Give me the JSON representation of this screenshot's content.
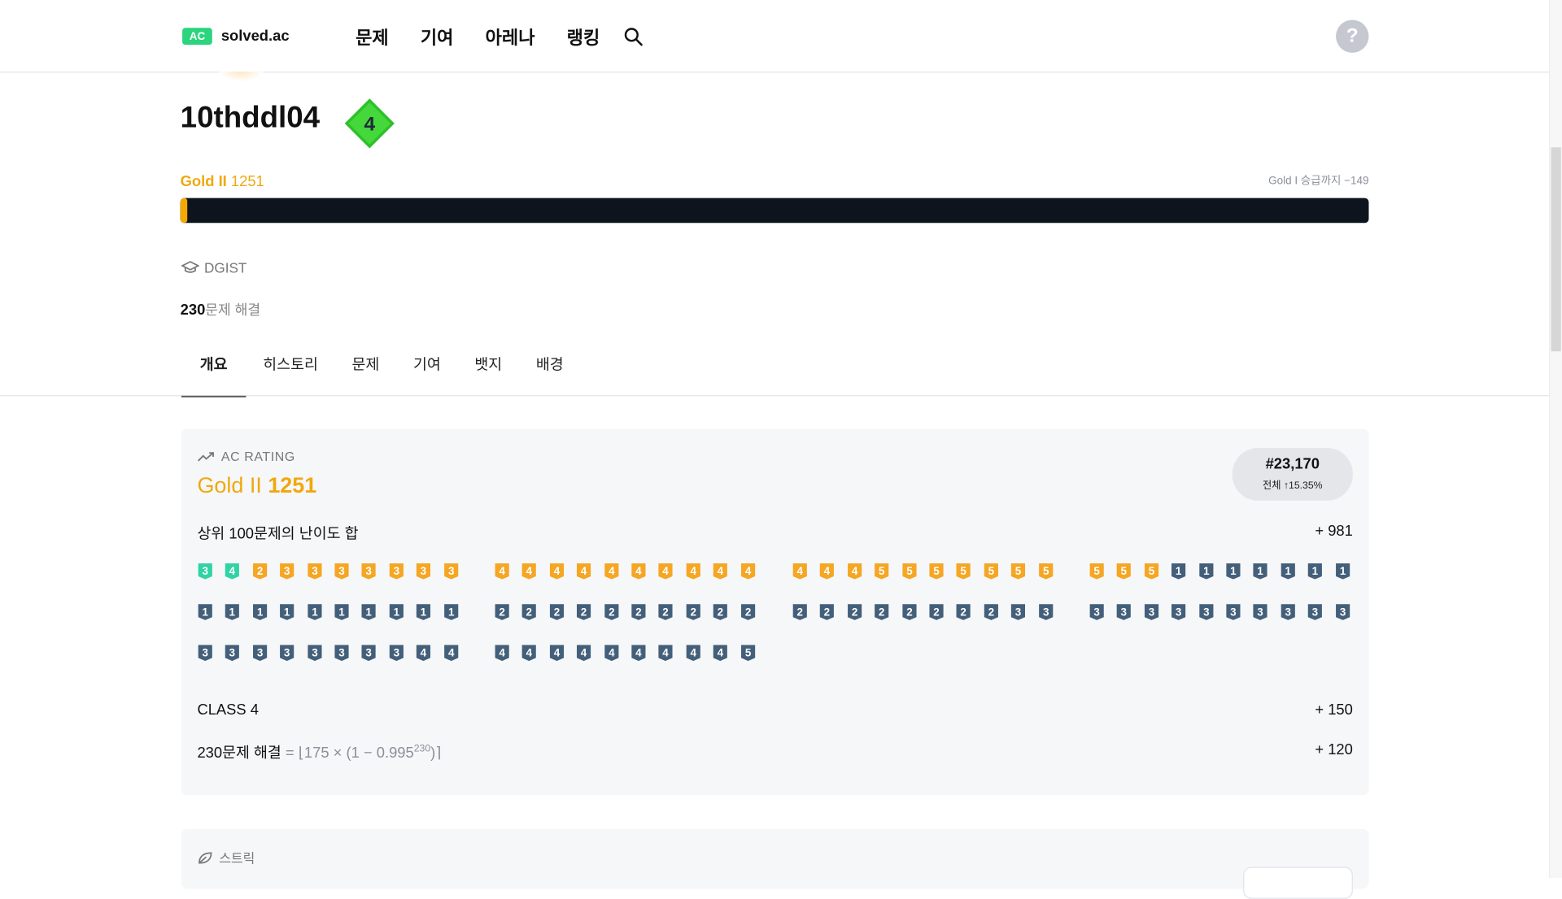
{
  "header": {
    "logo_badge": "AC",
    "logo_text": "solved.ac",
    "nav": [
      "문제",
      "기여",
      "아레나",
      "랭킹"
    ],
    "help_glyph": "?"
  },
  "profile": {
    "username": "10thddl04",
    "class_level": "4",
    "tier": "Gold II",
    "rating": "1251",
    "next_tier_text": "Gold I 승급까지 −149",
    "progress_fraction": 0.006,
    "organization": "DGIST",
    "solved_count": "230",
    "solved_suffix": "문제 해결"
  },
  "tabs": [
    "개요",
    "히스토리",
    "문제",
    "기여",
    "뱃지",
    "배경"
  ],
  "ac_rating": {
    "label": "AC RATING",
    "tier": "Gold II",
    "rating": "1251",
    "rank": "#23,170",
    "rank_sub": "전체 ↑15.35%",
    "top100_label": "상위 100문제의 난이도 합",
    "top100_value": "+ 981",
    "class_label": "CLASS 4",
    "class_value": "+ 150",
    "solved_label": "230문제 해결",
    "solved_formula_prefix": "= ⌊175 × (1 − 0.995",
    "solved_formula_exp": "230",
    "solved_formula_suffix": ")⌉",
    "solved_value": "+ 120"
  },
  "top100_tiers": [
    "S3",
    "S4",
    "G2",
    "G3",
    "G3",
    "G3",
    "G3",
    "G3",
    "G3",
    "G3",
    "G4",
    "G4",
    "G4",
    "G4",
    "G4",
    "G4",
    "G4",
    "G4",
    "G4",
    "G4",
    "G4",
    "G4",
    "G4",
    "G5",
    "G5",
    "G5",
    "G5",
    "G5",
    "G5",
    "G5",
    "G5",
    "G5",
    "G5",
    "B1",
    "B1",
    "B1",
    "B1",
    "B1",
    "B1",
    "B1",
    "B1",
    "B1",
    "B1",
    "B1",
    "B1",
    "B1",
    "B1",
    "B1",
    "B1",
    "B1",
    "B2",
    "B2",
    "B2",
    "B2",
    "B2",
    "B2",
    "B2",
    "B2",
    "B2",
    "B2",
    "B2",
    "B2",
    "B2",
    "B2",
    "B2",
    "B2",
    "B2",
    "B2",
    "B3",
    "B3",
    "B3",
    "B3",
    "B3",
    "B3",
    "B3",
    "B3",
    "B3",
    "B3",
    "B3",
    "B3",
    "B3",
    "B3",
    "B3",
    "B3",
    "B3",
    "B3",
    "B3",
    "B3",
    "B4",
    "B4",
    "B4",
    "B4",
    "B4",
    "B4",
    "B4",
    "B4",
    "B4",
    "B4",
    "B4",
    "B5"
  ],
  "tier_colors": {
    "gold": "#f5a623",
    "silver_s": "#2fd3a6",
    "bronze": "#435f7a"
  },
  "streak": {
    "label": "스트릭"
  },
  "icons": {
    "search": "search-icon",
    "org": "graduation-cap-icon",
    "trend": "trending-up-icon",
    "leaf": "leaf-icon"
  }
}
